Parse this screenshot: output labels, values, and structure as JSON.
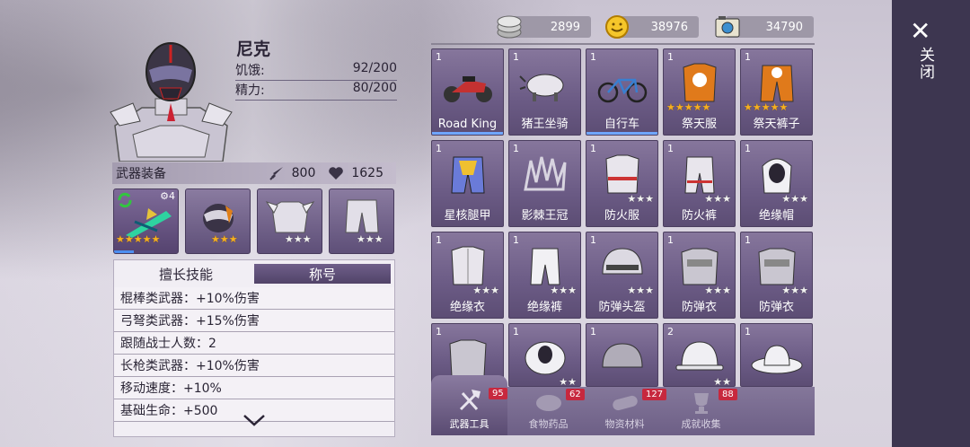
{
  "character": {
    "name": "尼克",
    "hunger_label": "饥饿:",
    "hunger_value": "92/200",
    "energy_label": "精力:",
    "energy_value": "80/200"
  },
  "equipment": {
    "title": "武器装备",
    "attack": "800",
    "health": "1625",
    "slots": [
      {
        "level": "4",
        "stars": "★★★★★",
        "star_type": "gold"
      },
      {
        "stars": "★★★",
        "star_type": "gold"
      },
      {
        "stars": "★★★",
        "star_type": "white"
      },
      {
        "stars": "★★★",
        "star_type": "white"
      }
    ]
  },
  "skills": {
    "tab_skills": "擅长技能",
    "tab_title": "称号",
    "rows": [
      "棍棒类武器：+10%伤害",
      "弓弩类武器：+15%伤害",
      "跟随战士人数：2",
      "长枪类武器：+10%伤害",
      "移动速度：+10%",
      "基础生命：+500"
    ]
  },
  "currency": {
    "silver": "2899",
    "gold": "38976",
    "photo": "34790"
  },
  "inventory": [
    {
      "qty": "1",
      "label": "Road King",
      "stars": "",
      "icon": "motorcycle-icon"
    },
    {
      "qty": "1",
      "label": "猪王坐骑",
      "stars": "",
      "icon": "boar-mount-icon"
    },
    {
      "qty": "1",
      "label": "自行车",
      "stars": "",
      "icon": "bicycle-icon"
    },
    {
      "qty": "1",
      "label": "祭天服",
      "stars": "★★★★★",
      "icon": "ceremonial-robe-icon"
    },
    {
      "qty": "1",
      "label": "祭天裤子",
      "stars": "★★★★★",
      "icon": "ceremonial-pants-icon"
    },
    {
      "qty": "1",
      "label": "星核腿甲",
      "stars": "",
      "icon": "star-core-leg-armor-icon"
    },
    {
      "qty": "1",
      "label": "影棘王冠",
      "stars": "",
      "icon": "thorn-crown-icon"
    },
    {
      "qty": "1",
      "label": "防火服",
      "stars": "★★★",
      "icon": "fire-suit-icon"
    },
    {
      "qty": "1",
      "label": "防火裤",
      "stars": "★★★",
      "icon": "fire-pants-icon"
    },
    {
      "qty": "1",
      "label": "绝缘帽",
      "stars": "★★★",
      "icon": "insulated-hood-icon"
    },
    {
      "qty": "1",
      "label": "绝缘衣",
      "stars": "★★★",
      "icon": "insulated-jacket-icon"
    },
    {
      "qty": "1",
      "label": "绝缘裤",
      "stars": "★★★",
      "icon": "insulated-pants-icon"
    },
    {
      "qty": "1",
      "label": "防弹头盔",
      "stars": "★★★",
      "icon": "bulletproof-helmet-icon"
    },
    {
      "qty": "1",
      "label": "防弹衣",
      "stars": "★★★",
      "icon": "bulletproof-vest-icon"
    },
    {
      "qty": "1",
      "label": "防弹衣",
      "stars": "★★★",
      "icon": "bulletproof-vest-icon"
    },
    {
      "qty": "1",
      "label": "",
      "stars": "★★",
      "icon": "armor-vest-icon"
    },
    {
      "qty": "1",
      "label": "",
      "stars": "★★",
      "icon": "shoulder-guard-icon"
    },
    {
      "qty": "1",
      "label": "",
      "stars": "",
      "icon": "helmet-icon"
    },
    {
      "qty": "2",
      "label": "",
      "stars": "★★",
      "icon": "hard-hat-icon"
    },
    {
      "qty": "1",
      "label": "",
      "stars": "",
      "icon": "sun-hat-icon"
    }
  ],
  "bottom_tabs": [
    {
      "label": "武器工具",
      "count": "95"
    },
    {
      "label": "食物药品",
      "count": "62"
    },
    {
      "label": "物资材料",
      "count": "127"
    },
    {
      "label": "成就收集",
      "count": "88"
    }
  ],
  "close": {
    "label": "关闭",
    "x": "✕"
  }
}
